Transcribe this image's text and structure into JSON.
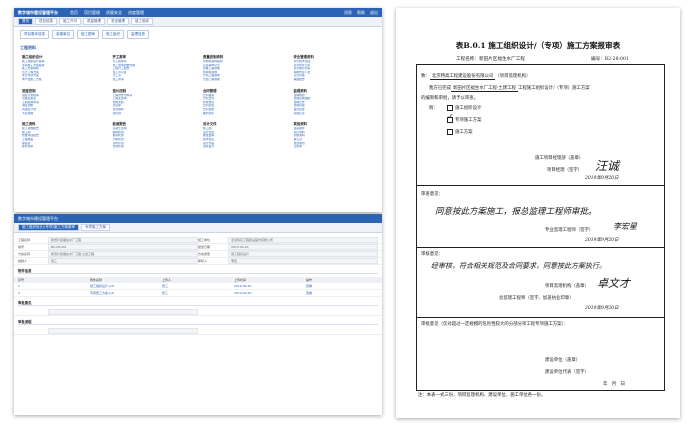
{
  "app1": {
    "title": "数字城市建设管理平台",
    "nav": [
      "首页",
      "项目管理",
      "质量安全",
      "进度管理"
    ],
    "user_area": [
      "消息",
      "帮助",
      "退出"
    ],
    "tabs": [
      "首页",
      "项目信息",
      "施工许可",
      "质量管理",
      "安全管理",
      "竣工验收"
    ],
    "subtabs": [
      "项目基本信息",
      "参建单位",
      "施工图审",
      "施工组织",
      "监理信息"
    ],
    "panel_title": "工程资料",
    "groups": [
      {
        "title": "施工组织设计",
        "items": [
          "施工组织设计报审",
          "专项施工方案报审",
          "施工方案审批",
          "危大工程方案",
          "安全专项方案",
          "季节性施工方案"
        ]
      },
      {
        "title": "开工报审",
        "items": [
          "开工报审表",
          "施工现场质量管理",
          "工程开工报告",
          "施工许可证",
          "开工令",
          "复工申请"
        ]
      },
      {
        "title": "质量控制资料",
        "items": [
          "原材料进场报验",
          "见证取样记录",
          "隐蔽工程验收",
          "检验批验收",
          "分项工程验收",
          "分部工程验收"
        ]
      },
      {
        "title": "安全管理资料",
        "items": [
          "安全技术交底",
          "安全检查记录",
          "安全教育培训",
          "特种作业人员",
          "应急预案",
          "事故报告"
        ]
      },
      {
        "title": "进度控制",
        "items": [
          "进度计划报审",
          "月进度报表",
          "工期延期申请",
          "进度调整",
          "周进度计划",
          "节点验收"
        ]
      },
      {
        "title": "造价控制",
        "items": [
          "工程款支付申请",
          "工程变更单",
          "费用索赔",
          "签证单",
          "结算资料",
          "预付款"
        ]
      },
      {
        "title": "合同管理",
        "items": [
          "合同备案",
          "分包合同",
          "补充协议",
          "合同变更",
          "合同台账",
          "履约评价"
        ]
      },
      {
        "title": "监理资料",
        "items": [
          "监理规划",
          "监理实施细则",
          "监理日志",
          "监理月报",
          "会议纪要",
          "旁站记录"
        ]
      },
      {
        "title": "竣工资料",
        "items": [
          "竣工验收报告",
          "竣工图",
          "质量评估报告",
          "工程档案",
          "备案表",
          "移交清单"
        ]
      },
      {
        "title": "检测报告",
        "items": [
          "混凝土试块",
          "钢筋检测",
          "桩基检测",
          "节能检测",
          "室内环境",
          "防雷检测"
        ]
      },
      {
        "title": "设计文件",
        "items": [
          "施工图",
          "设计变更",
          "图纸会审",
          "技术核定",
          "设计交底",
          "深化设计"
        ]
      },
      {
        "title": "其他资料",
        "items": [
          "往来函件",
          "照片资料",
          "影像资料",
          "备忘录",
          "整改通知",
          "回复单"
        ]
      }
    ]
  },
  "app2": {
    "title": "数字城市建设管理平台",
    "tabs": [
      "施工组织设计/(专项)施工方案报审",
      "专项施工方案"
    ],
    "fields": [
      {
        "label": "工程名称",
        "value": "新田片区福生水厂工程",
        "label2": "施工单位",
        "value2": "北京特高工程建设股份有限公司"
      },
      {
        "label": "编号",
        "value": "B2-28-001",
        "label2": "报送日期",
        "value2": "2019-09-20"
      },
      {
        "label": "方案名称",
        "value": "新田片区福生水厂工程-土建工程",
        "label2": "方案类型",
        "value2": "施工组织设计"
      },
      {
        "label": "编制人",
        "value": "张三",
        "label2": "审核人",
        "value2": "李四"
      }
    ],
    "section1": "附件信息",
    "table_head": [
      "序号",
      "附件名称",
      "上传人",
      "上传时间",
      "操作"
    ],
    "table_rows": [
      [
        "1",
        "施工组织设计.pdf",
        "张三",
        "2019-09-20",
        "查看"
      ],
      [
        "2",
        "专项施工方案.pdf",
        "张三",
        "2019-09-20",
        "查看"
      ]
    ],
    "section2": "审批意见",
    "section3": "审批流程"
  },
  "doc": {
    "title": "表B.0.1 施工组织设计/（专项）施工方案报审表",
    "project_label": "工程名称：",
    "project_name": "新田片区福生水厂工程",
    "no_label": "编号：",
    "no_value": "B2-28-001",
    "to_label": "致：",
    "to_value": "北京特高工程建设股份有限公司",
    "to_suffix": "（项目监理机构）",
    "line2_pre": "我方已完成",
    "line2_value": "新田片区福生水厂工程-土建工程",
    "line2_post": "工程施工组织设计/（专项）施工方案",
    "line3": "的编制和审批，请予以审查。",
    "attach_label": "附：",
    "options": [
      "施工组织设计",
      "专项施工方案",
      "施工方案"
    ],
    "checked_index": 1,
    "sign1_label": "施工项目经理部（盖章）",
    "sign1_person": "项目经理（签字）",
    "sign1_sig": "汪诚",
    "sign1_date": "2019年9月20日",
    "review_label": "审查意见：",
    "review_text": "同意按此方案施工，报总监理工程师审批。",
    "sign2_label": "专业监理工程师（签字）",
    "sign2_sig": "李宏星",
    "sign2_date": "2019年9月20日",
    "approve_label": "审核意见：",
    "approve_text": "经审核，符合相关规范及合同要求，同意按此方案执行。",
    "sign3_label": "项目监理机构（盖章）",
    "sign3_person": "总监理工程师（签字、加盖执业印章）",
    "sign3_sig": "卓文才",
    "sign3_date": "2019年9月20日",
    "owner_label": "审批意见（仅对超过一定规模的危险性较大的分部分项工程专项施工方案）：",
    "owner_sign_label": "建设单位（盖章）",
    "owner_person": "建设单位代表（签字）",
    "owner_date": "年　月　日",
    "note": "注：本表一式三份，项目监理机构、建设单位、施工单位各一份。"
  }
}
